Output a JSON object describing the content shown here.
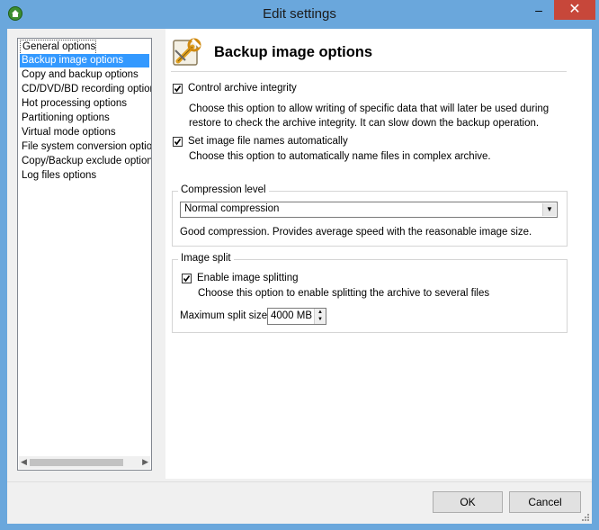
{
  "window": {
    "title": "Edit settings",
    "minimize_glyph": "–",
    "close_glyph": "✕",
    "app_icon": "home-icon"
  },
  "sidebar": {
    "items": [
      {
        "label": "General options"
      },
      {
        "label": "Backup image options",
        "selected": true
      },
      {
        "label": "Copy and backup options"
      },
      {
        "label": "CD/DVD/BD recording options"
      },
      {
        "label": "Hot processing options"
      },
      {
        "label": "Partitioning options"
      },
      {
        "label": "Virtual mode options"
      },
      {
        "label": "File system conversion options"
      },
      {
        "label": "Copy/Backup exclude options"
      },
      {
        "label": "Log files options"
      }
    ]
  },
  "main": {
    "header_icon": "settings-wrench-icon",
    "title": "Backup image options",
    "control_integrity": {
      "label": "Control archive integrity",
      "checked": true,
      "description": "Choose this option to allow writing of specific data that will later be used during restore to check the archive integrity. It can slow down the backup operation."
    },
    "auto_names": {
      "label": "Set image file names automatically",
      "checked": true,
      "description": "Choose this option to automatically name files in complex archive."
    },
    "compression": {
      "group_label": "Compression level",
      "selected": "Normal compression",
      "description": "Good compression. Provides average speed with the reasonable image size."
    },
    "split": {
      "group_label": "Image split",
      "enable_label": "Enable image splitting",
      "checked": true,
      "description": "Choose this option to enable splitting the archive to several files",
      "max_label": "Maximum split size:",
      "max_value": "4000 MB"
    }
  },
  "buttons": {
    "ok": "OK",
    "cancel": "Cancel"
  },
  "colors": {
    "titlebar": "#6aa7dc",
    "selection": "#3399ff",
    "close": "#c7473a"
  }
}
